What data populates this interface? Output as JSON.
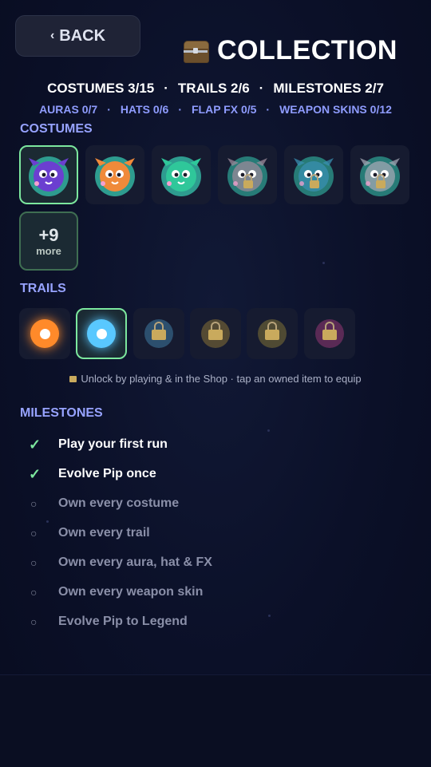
{
  "header": {
    "back_label": "BACK",
    "title": "COLLECTION"
  },
  "stats": {
    "primary": [
      "COSTUMES 3/15",
      "TRAILS 2/6",
      "MILESTONES 2/7"
    ],
    "secondary": [
      "AURAS 0/7",
      "HATS 0/6",
      "FLAP FX 0/5",
      "WEAPON SKINS 0/12"
    ],
    "separator": "·"
  },
  "costumes": {
    "title": "COSTUMES",
    "items": [
      {
        "name": "purple",
        "color": "#6b3fd0",
        "owned": true,
        "selected": true
      },
      {
        "name": "orange",
        "color": "#f08a3a",
        "owned": true,
        "selected": false
      },
      {
        "name": "teal",
        "color": "#2fc79a",
        "owned": true,
        "selected": false
      },
      {
        "name": "gray-pink",
        "color": "#9b8a9a",
        "owned": false,
        "selected": false
      },
      {
        "name": "blue",
        "color": "#3a8fb0",
        "owned": false,
        "selected": false
      },
      {
        "name": "gray",
        "color": "#a3a7b3",
        "owned": false,
        "selected": false
      }
    ],
    "more_count": "+9",
    "more_label": "more"
  },
  "trails": {
    "title": "TRAILS",
    "items": [
      {
        "color": "#ff8a2a",
        "owned": true,
        "selected": false
      },
      {
        "color": "#59c8ff",
        "owned": true,
        "selected": true
      },
      {
        "color": "#2c4f6e",
        "owned": false,
        "selected": false
      },
      {
        "color": "#544a33",
        "owned": false,
        "selected": false
      },
      {
        "color": "#4f4a33",
        "owned": false,
        "selected": false
      },
      {
        "color": "#5a2a55",
        "owned": false,
        "selected": false
      }
    ]
  },
  "hint": "Unlock by playing & in the Shop · tap an owned item to equip",
  "milestones": {
    "title": "MILESTONES",
    "items": [
      {
        "label": "Play your first run",
        "done": true
      },
      {
        "label": "Evolve Pip once",
        "done": true
      },
      {
        "label": "Own every costume",
        "done": false
      },
      {
        "label": "Own every trail",
        "done": false
      },
      {
        "label": "Own every aura, hat & FX",
        "done": false
      },
      {
        "label": "Own every weapon skin",
        "done": false
      },
      {
        "label": "Evolve Pip to Legend",
        "done": false
      }
    ],
    "done_mark": "✓",
    "todo_mark": "○"
  },
  "colors": {
    "accent": "#97a3ff",
    "selected_border": "#7ce79e",
    "background": "#0b1028"
  }
}
